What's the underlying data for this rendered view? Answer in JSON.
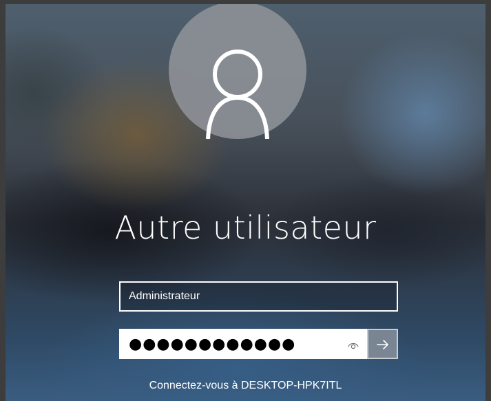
{
  "login": {
    "user_display_name": "Autre utilisateur",
    "username_value": "Administrateur",
    "password_mask": "●●●●●●●●●●●●",
    "reveal_icon": "eye-icon",
    "submit_icon": "arrow-right-icon",
    "connect_to_text": "Connectez-vous à DESKTOP-HPK7ITL"
  },
  "colors": {
    "text": "#ffffff",
    "avatar_bg": "#8c8f96",
    "submit_bg": "#828c98"
  }
}
